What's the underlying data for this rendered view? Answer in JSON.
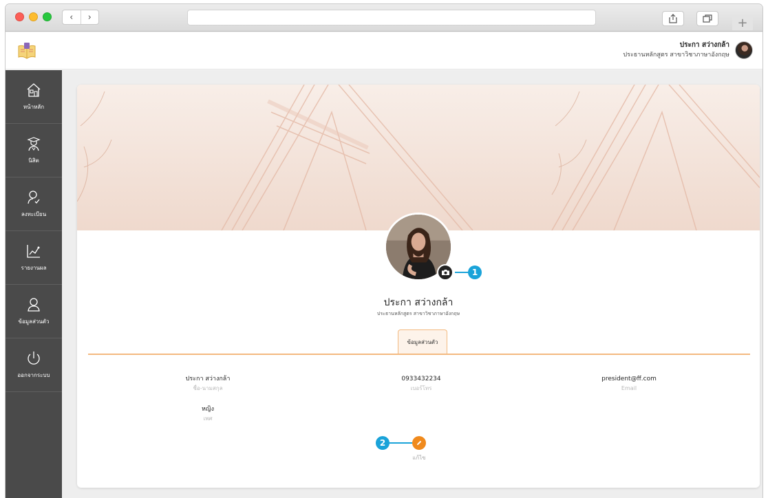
{
  "browser": {
    "back_icon": "chevron-left-icon",
    "forward_icon": "chevron-right-icon",
    "address": "",
    "share_icon": "share-icon",
    "tabs_icon": "tabs-icon",
    "newtab_label": "+"
  },
  "header": {
    "logo_icon": "book-logo-icon",
    "user_name": "ประกา สว่างกล้า",
    "user_role": "ประธานหลักสูตร สาขาวิชาภาษาอังกฤษ"
  },
  "sidebar": {
    "items": [
      {
        "label": "หน้าหลัก",
        "icon": "home-icon"
      },
      {
        "label": "นิสิต",
        "icon": "graduate-icon"
      },
      {
        "label": "ลงทะเบียน",
        "icon": "user-check-icon"
      },
      {
        "label": "รายงานผล",
        "icon": "chart-icon"
      },
      {
        "label": "ข้อมูลส่วนตัว",
        "icon": "user-icon"
      },
      {
        "label": "ออกจากระบบ",
        "icon": "power-icon"
      }
    ]
  },
  "profile": {
    "name": "ประกา สว่างกล้า",
    "role": "ประธานหลักสูตร สาขาวิชาภาษาอังกฤษ",
    "camera_icon": "camera-icon",
    "callout_1": "1",
    "callout_2": "2"
  },
  "tabs": [
    {
      "label": "ข้อมูลส่วนตัว",
      "active": true
    }
  ],
  "fields": {
    "fullname": {
      "value": "ประกา สว่างกล้า",
      "label": "ชื่อ-นามสกุล"
    },
    "phone": {
      "value": "0933432234",
      "label": "เบอร์โทร"
    },
    "email": {
      "value": "president@ff.com",
      "label": "Email"
    },
    "gender": {
      "value": "หญิง",
      "label": "เพศ"
    }
  },
  "edit": {
    "label": "แก้ไข",
    "icon": "pencil-icon"
  },
  "colors": {
    "sidebar": "#4a4a4a",
    "accent": "#f08a1d",
    "tab_border": "#f3b97f",
    "callout": "#1aa3d9"
  }
}
